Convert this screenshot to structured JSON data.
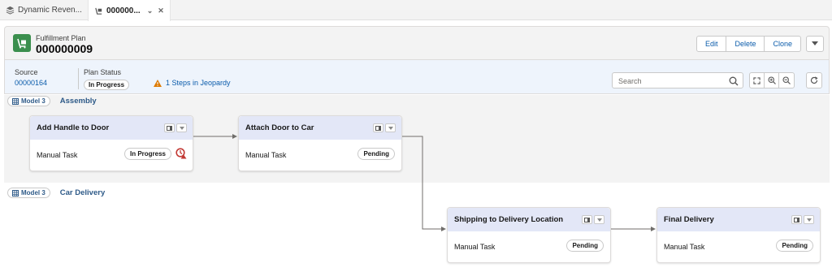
{
  "tabs": [
    {
      "label": "Dynamic Reven...",
      "icon": "layers-icon"
    },
    {
      "label": "000000...",
      "icon": "fulfillment-icon"
    }
  ],
  "header": {
    "object_label": "Fulfillment Plan",
    "title": "000000009",
    "actions": [
      "Edit",
      "Delete",
      "Clone"
    ]
  },
  "highlights": {
    "source_label": "Source",
    "source_value": "00000164",
    "plan_status_label": "Plan Status",
    "plan_status_value": "In Progress",
    "jeopardy_text": "1 Steps in Jeopardy"
  },
  "toolbar": {
    "search_placeholder": "Search"
  },
  "lanes": [
    {
      "model": "Model 3",
      "name": "Assembly"
    },
    {
      "model": "Model 3",
      "name": "Car Delivery"
    }
  ],
  "tasks": [
    {
      "title": "Add Handle to Door",
      "type": "Manual Task",
      "status": "In Progress",
      "jeopardy": true
    },
    {
      "title": "Attach Door to Car",
      "type": "Manual Task",
      "status": "Pending"
    },
    {
      "title": "Shipping to Delivery Location",
      "type": "Manual Task",
      "status": "Pending"
    },
    {
      "title": "Final Delivery",
      "type": "Manual Task",
      "status": "Pending"
    }
  ],
  "colors": {
    "brand_icon": "#3b8f4e",
    "link": "#0b5cab",
    "lane_label": "#2e5a88",
    "card_header": "#e3e7f7",
    "warning": "#dd7a01",
    "jeopardy_alert": "#c23934"
  }
}
